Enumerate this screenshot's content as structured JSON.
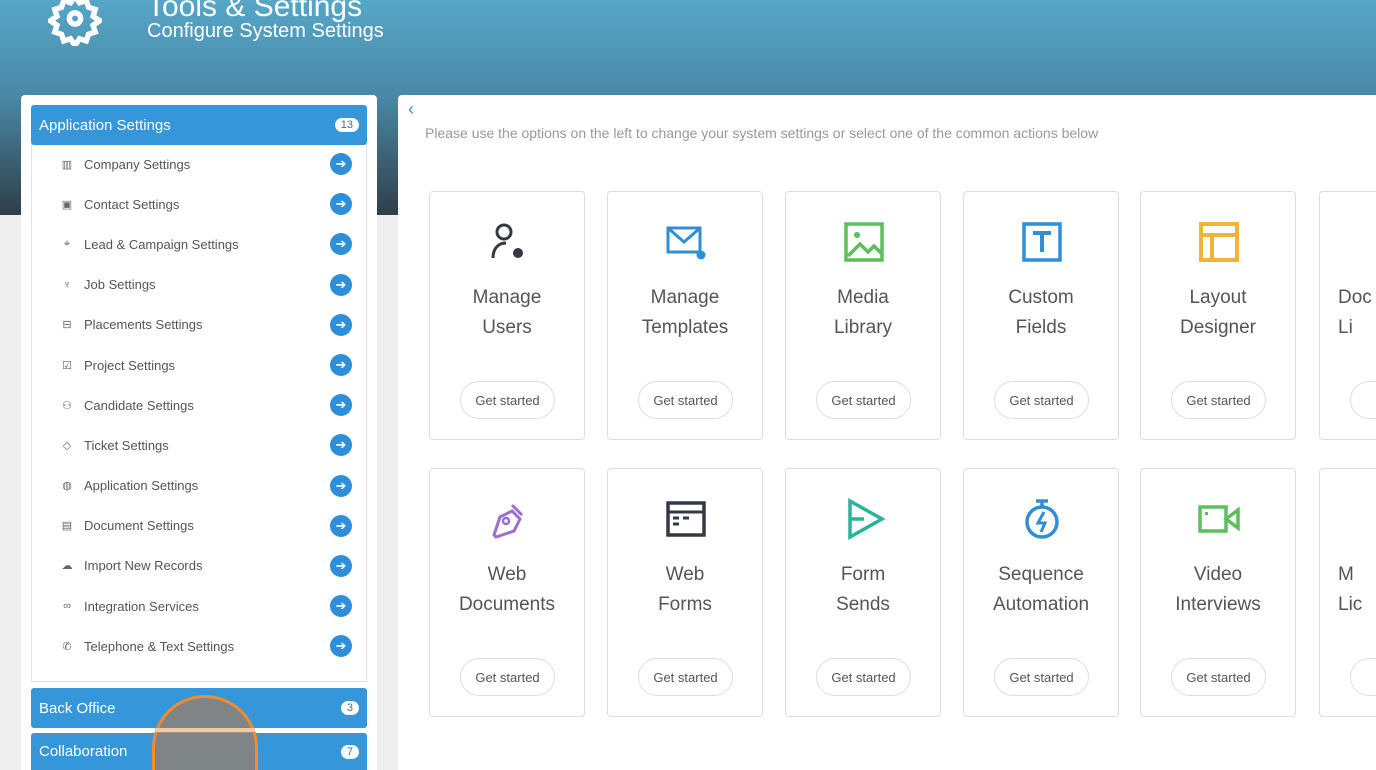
{
  "header": {
    "title": "Tools & Settings",
    "subtitle": "Configure System Settings"
  },
  "sidebar": {
    "groups": [
      {
        "label": "Application Settings",
        "count": "13"
      },
      {
        "label": "Back Office",
        "count": "3"
      },
      {
        "label": "Collaboration",
        "count": "7"
      }
    ],
    "items": [
      {
        "label": "Company Settings",
        "icon": "▥",
        "name": "building-icon"
      },
      {
        "label": "Contact Settings",
        "icon": "▣",
        "name": "contact-card-icon"
      },
      {
        "label": "Lead & Campaign Settings",
        "icon": "⌖",
        "name": "target-icon"
      },
      {
        "label": "Job Settings",
        "icon": "♆",
        "name": "trophy-icon"
      },
      {
        "label": "Placements Settings",
        "icon": "⊟",
        "name": "briefcase-icon"
      },
      {
        "label": "Project Settings",
        "icon": "☑",
        "name": "checkbox-icon"
      },
      {
        "label": "Candidate Settings",
        "icon": "⚇",
        "name": "users-icon"
      },
      {
        "label": "Ticket Settings",
        "icon": "◇",
        "name": "tag-icon"
      },
      {
        "label": "Application Settings",
        "icon": "◍",
        "name": "globe-icon"
      },
      {
        "label": "Document Settings",
        "icon": "▤",
        "name": "document-icon"
      },
      {
        "label": "Import New Records",
        "icon": "☁",
        "name": "cloud-upload-icon"
      },
      {
        "label": "Integration Services",
        "icon": "∞",
        "name": "link-icon"
      },
      {
        "label": "Telephone & Text Settings",
        "icon": "✆",
        "name": "phone-icon"
      }
    ]
  },
  "main": {
    "intro": "Please use the options on the left to change your system settings or select one of the common actions below",
    "button_label": "Get started",
    "cards": [
      {
        "line1": "Manage",
        "line2": "Users",
        "icon": "user-gear-icon",
        "color": "#333a45"
      },
      {
        "line1": "Manage",
        "line2": "Templates",
        "icon": "mail-gear-icon",
        "color": "#2e8fd8"
      },
      {
        "line1": "Media",
        "line2": "Library",
        "icon": "image-icon",
        "color": "#5cbf5c"
      },
      {
        "line1": "Custom",
        "line2": "Fields",
        "icon": "text-box-icon",
        "color": "#2e8fd8"
      },
      {
        "line1": "Layout",
        "line2": "Designer",
        "icon": "layout-icon",
        "color": "#f0b43c"
      },
      {
        "line1": "Doc",
        "line2": "Li",
        "icon": "",
        "color": "#333"
      },
      {
        "line1": "Web",
        "line2": "Documents",
        "icon": "pen-icon",
        "color": "#9b6fd6"
      },
      {
        "line1": "Web",
        "line2": "Forms",
        "icon": "browser-icon",
        "color": "#333a45"
      },
      {
        "line1": "Form",
        "line2": "Sends",
        "icon": "send-icon",
        "color": "#2bb39a"
      },
      {
        "line1": "Sequence",
        "line2": "Automation",
        "icon": "stopwatch-icon",
        "color": "#2e8fd8"
      },
      {
        "line1": "Video",
        "line2": "Interviews",
        "icon": "video-icon",
        "color": "#5cbf5c"
      },
      {
        "line1": "M",
        "line2": "Lic",
        "icon": "",
        "color": "#333"
      }
    ]
  }
}
